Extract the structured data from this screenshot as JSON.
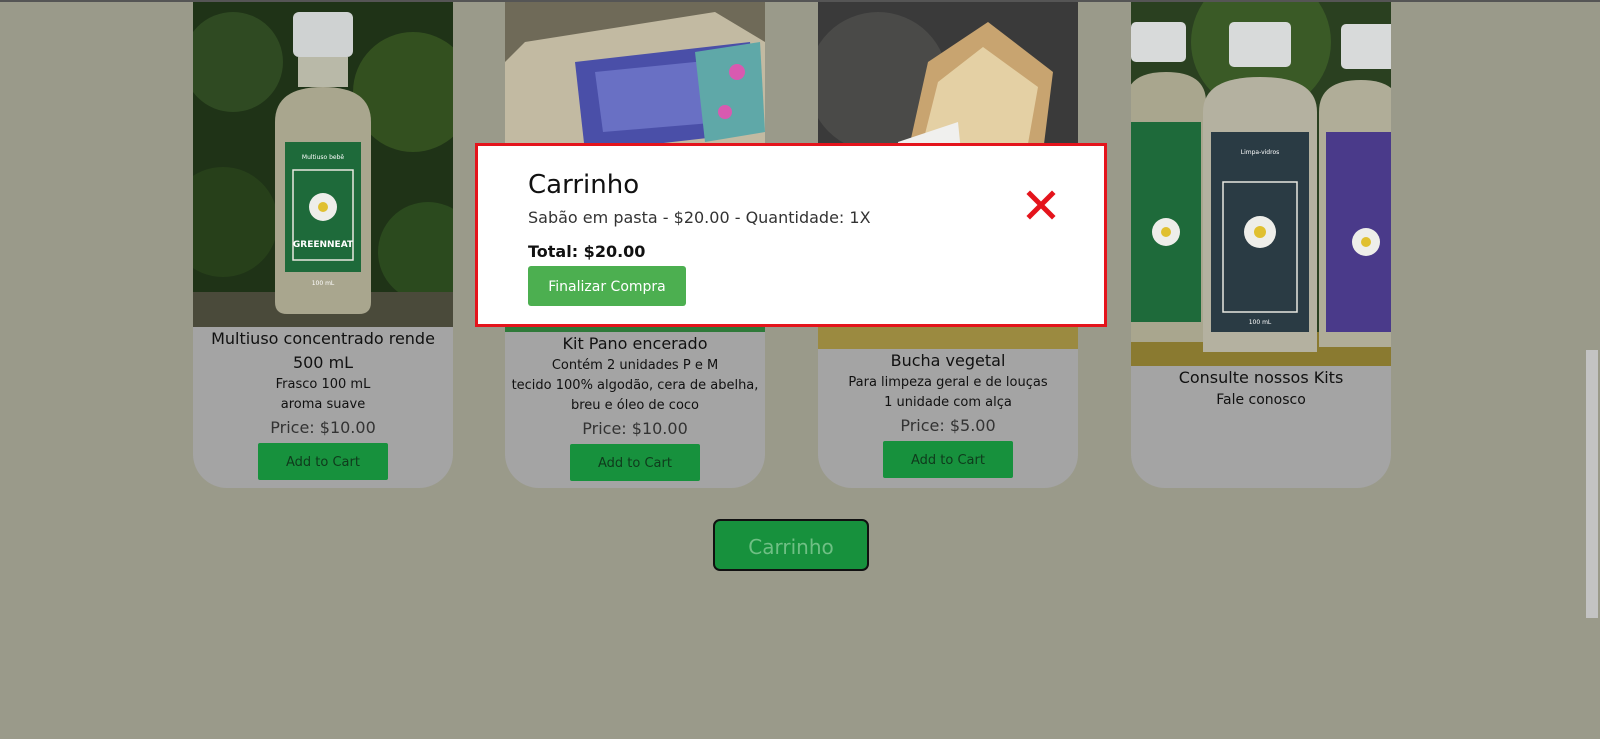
{
  "products": [
    {
      "name": "Multiuso concentrado rende 500 mL",
      "desc": [
        "Frasco 100 mL",
        "aroma suave"
      ],
      "price": "Price: $10.00",
      "button": "Add to Cart"
    },
    {
      "name": "Kit Pano encerado",
      "desc": [
        "Contém 2 unidades P e M",
        "tecido 100% algodão, cera de abelha,",
        "breu e óleo de coco"
      ],
      "price": "Price: $10.00",
      "button": "Add to Cart"
    },
    {
      "name": "Bucha vegetal",
      "desc": [
        "Para limpeza geral e de louças",
        "1 unidade com alça"
      ],
      "price": "Price: $5.00",
      "button": "Add to Cart"
    },
    {
      "name": "Consulte nossos Kits",
      "desc": [
        "Fale conosco"
      ]
    }
  ],
  "cart_toggle_label": "Carrinho",
  "modal": {
    "title": "Carrinho",
    "item_line": "Sabão em pasta - $20.00 - Quantidade: 1X",
    "total": "Total: $20.00",
    "checkout_label": "Finalizar Compra"
  },
  "bottle_labels": {
    "brand": "GREENNEAT",
    "multiuso": "Multiuso bebê",
    "limpa_vidros": "Limpa-vidros",
    "volume": "100 mL"
  },
  "colors": {
    "overlay_bg": "#9a9a8a",
    "button_green": "#17913d",
    "checkout_green": "#4caf50",
    "modal_border": "#e4141c",
    "close_red": "#e4141c"
  }
}
